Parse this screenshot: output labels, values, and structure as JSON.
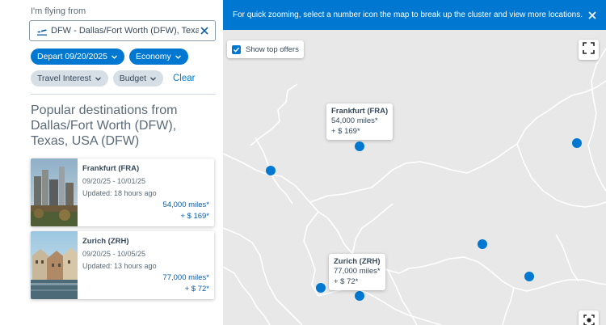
{
  "search": {
    "from_label": "I'm flying from",
    "origin_value": "DFW - Dallas/Fort Worth (DFW), Texas, U...",
    "filters": {
      "depart": "Depart 09/20/2025",
      "cabin": "Economy",
      "travel_interest": "Travel Interest",
      "budget": "Budget",
      "clear": "Clear"
    }
  },
  "popular": {
    "heading": "Popular destinations from Dallas/Fort Worth (DFW), Texas, USA (DFW)",
    "cards": [
      {
        "destination": "Frankfurt (FRA)",
        "dates": "09/20/25 - 10/01/25",
        "updated": "Updated: 18 hours ago",
        "miles": "54,000 miles*",
        "price": "+ $ 169*"
      },
      {
        "destination": "Zurich (ZRH)",
        "dates": "09/20/25 - 10/05/25",
        "updated": "Updated: 13 hours ago",
        "miles": "77,000 miles*",
        "price": "+ $ 72*"
      }
    ]
  },
  "map": {
    "banner": "For quick zooming, select a number icon the map to break up the cluster and view more locations.",
    "show_top_offers": "Show top offers",
    "show_top_offers_checked": true,
    "popups": [
      {
        "destination": "Frankfurt (FRA)",
        "miles": "54,000 miles*",
        "price": "+ $ 169*"
      },
      {
        "destination": "Zurich (ZRH)",
        "miles": "77,000 miles*",
        "price": "+ $ 72*"
      }
    ]
  },
  "colors": {
    "accent": "#0078d2",
    "chip_grey": "#d6dee6",
    "map_land": "#e8e8e8",
    "map_border": "#ffffff"
  },
  "icons": {
    "origin": "airplane-takeoff-icon",
    "clear_origin": "close-icon",
    "chip": "chevron-down-icon",
    "banner_close": "close-icon",
    "fullscreen": "fullscreen-icon",
    "locate": "locate-icon"
  }
}
